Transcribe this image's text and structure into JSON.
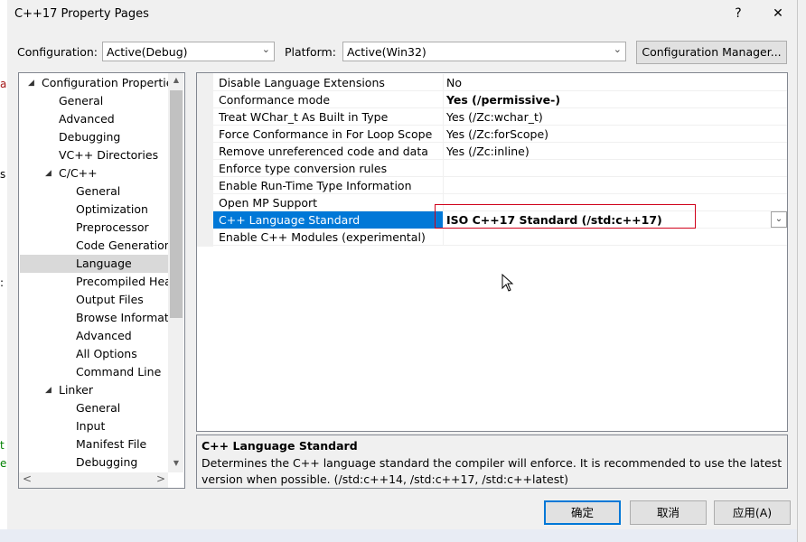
{
  "window": {
    "title": "C++17 Property Pages",
    "help_label": "?",
    "close_label": "✕"
  },
  "background": {
    "fragments": [
      "a",
      "s",
      ":",
      "t",
      "e"
    ]
  },
  "config_bar": {
    "configuration_label": "Configuration:",
    "configuration_value": "Active(Debug)",
    "platform_label": "Platform:",
    "platform_value": "Active(Win32)",
    "config_manager_label": "Configuration Manager..."
  },
  "tree": {
    "items": [
      {
        "label": "Configuration Properties",
        "expander": "◢"
      },
      {
        "label": "General"
      },
      {
        "label": "Advanced"
      },
      {
        "label": "Debugging"
      },
      {
        "label": "VC++ Directories"
      },
      {
        "label": "C/C++",
        "expander": "◢"
      },
      {
        "label": "General"
      },
      {
        "label": "Optimization"
      },
      {
        "label": "Preprocessor"
      },
      {
        "label": "Code Generation"
      },
      {
        "label": "Language"
      },
      {
        "label": "Precompiled Headers"
      },
      {
        "label": "Output Files"
      },
      {
        "label": "Browse Information"
      },
      {
        "label": "Advanced"
      },
      {
        "label": "All Options"
      },
      {
        "label": "Command Line"
      },
      {
        "label": "Linker",
        "expander": "◢"
      },
      {
        "label": "General"
      },
      {
        "label": "Input"
      },
      {
        "label": "Manifest File"
      },
      {
        "label": "Debugging"
      }
    ],
    "selected_index": 10,
    "scroll_up": "▲",
    "scroll_down": "▼",
    "scroll_left": "<",
    "scroll_right": ">"
  },
  "properties": {
    "rows": [
      {
        "name": "Disable Language Extensions",
        "value": "No",
        "bold": false
      },
      {
        "name": "Conformance mode",
        "value": "Yes (/permissive-)",
        "bold": true
      },
      {
        "name": "Treat WChar_t As Built in Type",
        "value": "Yes (/Zc:wchar_t)",
        "bold": false
      },
      {
        "name": "Force Conformance in For Loop Scope",
        "value": "Yes (/Zc:forScope)",
        "bold": false
      },
      {
        "name": "Remove unreferenced code and data",
        "value": "Yes (/Zc:inline)",
        "bold": false
      },
      {
        "name": "Enforce type conversion rules",
        "value": "",
        "bold": false
      },
      {
        "name": "Enable Run-Time Type Information",
        "value": "",
        "bold": false
      },
      {
        "name": "Open MP Support",
        "value": "",
        "bold": false
      },
      {
        "name": "C++ Language Standard",
        "value": "ISO C++17 Standard (/std:c++17)",
        "bold": true
      },
      {
        "name": "Enable C++ Modules (experimental)",
        "value": "",
        "bold": false
      }
    ],
    "selected_index": 8,
    "dropdown_arrow": "⌄"
  },
  "description": {
    "title": "C++ Language Standard",
    "text": "Determines the C++ language standard the compiler will enforce. It is recommended to use the latest version when possible. (/std:c++14, /std:c++17, /std:c++latest)"
  },
  "buttons": {
    "ok": "确定",
    "cancel": "取消",
    "apply": "应用(A)"
  },
  "colors": {
    "selection": "#0078d7",
    "highlight_box": "#d0021b",
    "tree_selection": "#d9d9d9"
  }
}
